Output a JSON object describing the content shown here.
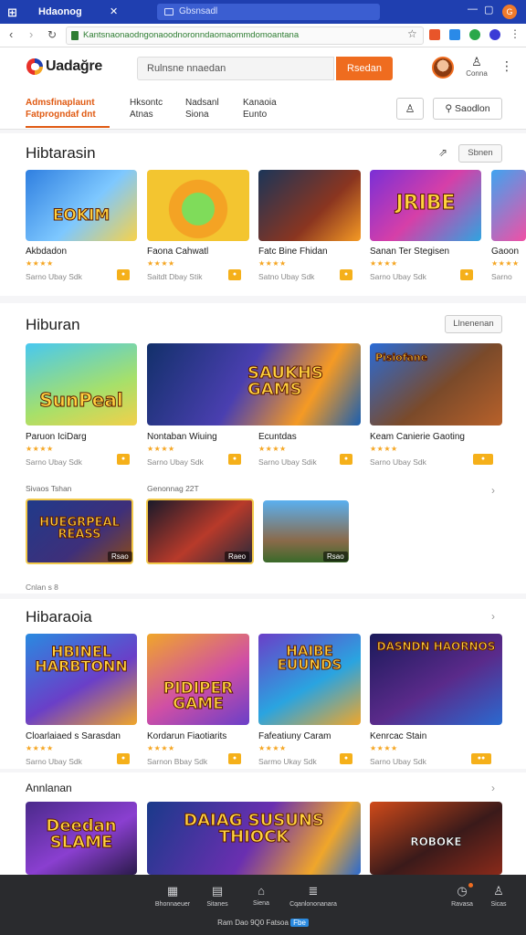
{
  "browser": {
    "tab_title": "Hdaonog",
    "tab2_title": "Gbsnsadl",
    "url": "Kantsnaonaodngonaoodnoronndaomaommdomoantana",
    "brand_color": "#1f3fb0"
  },
  "header": {
    "logo_text": "Uadağre",
    "search_placeholder": "Rulnsne nnaedan",
    "search_button": "Rsedan",
    "user_label": "Conna",
    "nav_tabs": [
      {
        "line1": "Admsfinaplaunt",
        "line2": "Fatprogndaf dnt"
      },
      {
        "line1": "Hksontc",
        "line2": "Atnas"
      },
      {
        "line1": "Nadsanl",
        "line2": "Siona"
      },
      {
        "line1": "Kanaoia",
        "line2": "Eunto"
      }
    ],
    "signin_button": "Saodlon",
    "accent_color": "#ef6c1f"
  },
  "section1": {
    "title": "Hibtarasin",
    "button": "Sbnen",
    "cards": [
      {
        "title": "Akbdadon",
        "rating": "★★★★",
        "meta": "Sarno Ubay Sdk",
        "tag": "●",
        "art": "EOKIM"
      },
      {
        "title": "Faona Cahwatl",
        "rating": "★★★★",
        "meta": "Saitdt Dbay Stik",
        "tag": "●",
        "art": ""
      },
      {
        "title": "Fatc Bine Fhidan",
        "rating": "★★★★",
        "meta": "Satno Ubay Sdk",
        "tag": "●",
        "art": ""
      },
      {
        "title": "Sanan Ter Stegisen",
        "rating": "★★★★",
        "meta": "Sarno Ubay Sdk",
        "tag": "●",
        "art": "JRIBE"
      },
      {
        "title": "Gaoon",
        "rating": "★★★★",
        "meta": "Sarno",
        "tag": "",
        "art": ""
      }
    ]
  },
  "section2": {
    "title": "Hiburan",
    "button": "Llnenenan",
    "cards": [
      {
        "title": "Paruon IciDarg",
        "rating": "★★★★",
        "meta": "Sarno Ubay Sdk",
        "tag": "●",
        "art": "SunPeal"
      },
      {
        "title": "Nontaban Wiuing",
        "rating": "★★★★",
        "meta": "Sarno Ubay Sdk",
        "tag": "●",
        "art": "SAUKHS GAMS"
      },
      {
        "title": "Ecuntdas",
        "rating": "★★★★",
        "meta": "Sarno Ubay Sdik",
        "tag": "●",
        "art": ""
      },
      {
        "title": "Keam Canierie Gaoting",
        "rating": "★★★★",
        "meta": "Sarno Ubay Sdk",
        "tag": "●",
        "art": "Pisiofane"
      }
    ],
    "sub_labels": [
      "Sivaos Tshan",
      "Genonnag 22T"
    ],
    "mini_cards": [
      {
        "art": "HUEGRPEAL REASS",
        "tag": "Rsao"
      },
      {
        "art": "",
        "tag": "Raeo"
      },
      {
        "art": "",
        "tag": "Rsao"
      }
    ],
    "footer_label": "Cnlan s 8"
  },
  "section3": {
    "title": "Hibaraoia",
    "cards": [
      {
        "title": "Cloarlaiaed s Sarasdan",
        "rating": "★★★★",
        "meta": "Sarno Ubay Sdk",
        "tag": "●",
        "art": "HBINEL HARBTONN"
      },
      {
        "title": "Kordarun Fiaotiarits",
        "rating": "★★★★",
        "meta": "Sarnon Bbay Sdk",
        "tag": "●",
        "art": "PIDIPER GAME"
      },
      {
        "title": "Fafeatiuny Caram",
        "rating": "★★★★",
        "meta": "Sarmo Ukay Sdk",
        "tag": "●",
        "art": "HAIBE EUUNDS"
      },
      {
        "title": "Kenrcac Stain",
        "rating": "★★★★",
        "meta": "Sarno Ubay Sdk",
        "tag": "●●",
        "art": "DASNDN HAORNOS"
      }
    ]
  },
  "section4": {
    "title": "Annlanan",
    "cards": [
      {
        "art": "Deedan SLAME"
      },
      {
        "art": "DAIAG SUSUNS THIOCK"
      },
      {
        "art": "ROBOKE"
      }
    ]
  },
  "bottom_nav": {
    "items": [
      {
        "label": "Bhonnaeuer",
        "icon": "grid-icon"
      },
      {
        "label": "Sitanes",
        "icon": "list-icon"
      },
      {
        "label": "Siena",
        "icon": "bag-icon"
      },
      {
        "label": "Cqanlononanara",
        "icon": "menu-icon"
      },
      {
        "label": "Ravasa",
        "icon": "clock-icon"
      },
      {
        "label": "Sicas",
        "icon": "person-icon"
      }
    ],
    "footer": "Ram Dao 9Q0 Fatsoa",
    "footer_badge": "Fbe"
  }
}
